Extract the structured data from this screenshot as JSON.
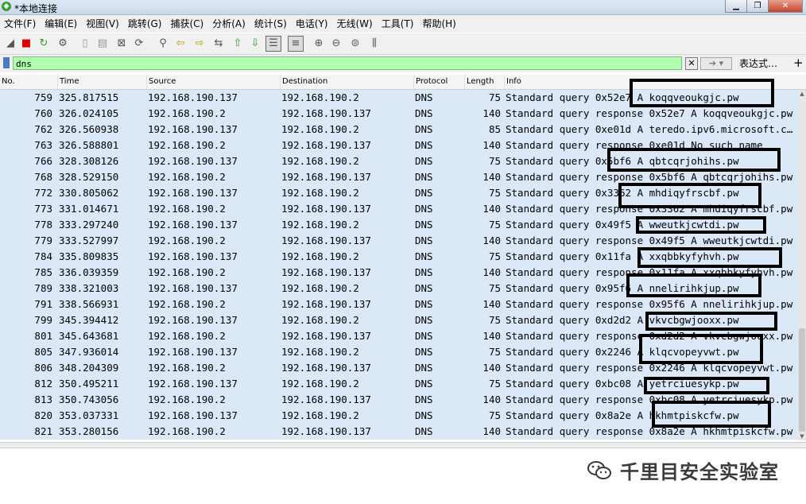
{
  "window": {
    "title": "*本地连接"
  },
  "menu": [
    "文件(F)",
    "编辑(E)",
    "视图(V)",
    "跳转(G)",
    "捕获(C)",
    "分析(A)",
    "统计(S)",
    "电话(Y)",
    "无线(W)",
    "工具(T)",
    "帮助(H)"
  ],
  "filter": {
    "value": "dns",
    "expression_label": "表达式…",
    "add_label": "+"
  },
  "columns": {
    "no": "No.",
    "time": "Time",
    "source": "Source",
    "destination": "Destination",
    "protocol": "Protocol",
    "length": "Length",
    "info": "Info"
  },
  "packets": [
    {
      "no": "759",
      "time": "325.817515",
      "src": "192.168.190.137",
      "dst": "192.168.190.2",
      "proto": "DNS",
      "len": "75",
      "info": "Standard query 0x52e7 A koqqveoukgjc.pw"
    },
    {
      "no": "760",
      "time": "326.024105",
      "src": "192.168.190.2",
      "dst": "192.168.190.137",
      "proto": "DNS",
      "len": "140",
      "info": "Standard query response 0x52e7 A koqqveoukgjc.pw"
    },
    {
      "no": "762",
      "time": "326.560938",
      "src": "192.168.190.137",
      "dst": "192.168.190.2",
      "proto": "DNS",
      "len": "85",
      "info": "Standard query 0xe01d A teredo.ipv6.microsoft.com"
    },
    {
      "no": "763",
      "time": "326.588801",
      "src": "192.168.190.2",
      "dst": "192.168.190.137",
      "proto": "DNS",
      "len": "140",
      "info": "Standard query response 0xe01d No such name"
    },
    {
      "no": "766",
      "time": "328.308126",
      "src": "192.168.190.137",
      "dst": "192.168.190.2",
      "proto": "DNS",
      "len": "75",
      "info": "Standard query 0x5bf6 A qbtcqrjohihs.pw"
    },
    {
      "no": "768",
      "time": "328.529150",
      "src": "192.168.190.2",
      "dst": "192.168.190.137",
      "proto": "DNS",
      "len": "140",
      "info": "Standard query response 0x5bf6 A qbtcqrjohihs.pw"
    },
    {
      "no": "772",
      "time": "330.805062",
      "src": "192.168.190.137",
      "dst": "192.168.190.2",
      "proto": "DNS",
      "len": "75",
      "info": "Standard query 0x3362 A mhdiqyfrscbf.pw"
    },
    {
      "no": "773",
      "time": "331.014671",
      "src": "192.168.190.2",
      "dst": "192.168.190.137",
      "proto": "DNS",
      "len": "140",
      "info": "Standard query response 0x3362 A mhdiqyfrscbf.pw"
    },
    {
      "no": "778",
      "time": "333.297240",
      "src": "192.168.190.137",
      "dst": "192.168.190.2",
      "proto": "DNS",
      "len": "75",
      "info": "Standard query 0x49f5 A wweutkjcwtdi.pw"
    },
    {
      "no": "779",
      "time": "333.527997",
      "src": "192.168.190.2",
      "dst": "192.168.190.137",
      "proto": "DNS",
      "len": "140",
      "info": "Standard query response 0x49f5 A wweutkjcwtdi.pw"
    },
    {
      "no": "784",
      "time": "335.809835",
      "src": "192.168.190.137",
      "dst": "192.168.190.2",
      "proto": "DNS",
      "len": "75",
      "info": "Standard query 0x11fa A xxqbbkyfyhvh.pw"
    },
    {
      "no": "785",
      "time": "336.039359",
      "src": "192.168.190.2",
      "dst": "192.168.190.137",
      "proto": "DNS",
      "len": "140",
      "info": "Standard query response 0x11fa A xxqbbkyfyhvh.pw"
    },
    {
      "no": "789",
      "time": "338.321003",
      "src": "192.168.190.137",
      "dst": "192.168.190.2",
      "proto": "DNS",
      "len": "75",
      "info": "Standard query 0x95f6 A nnelirihkjup.pw"
    },
    {
      "no": "791",
      "time": "338.566931",
      "src": "192.168.190.2",
      "dst": "192.168.190.137",
      "proto": "DNS",
      "len": "140",
      "info": "Standard query response 0x95f6 A nnelirihkjup.pw"
    },
    {
      "no": "799",
      "time": "345.394412",
      "src": "192.168.190.137",
      "dst": "192.168.190.2",
      "proto": "DNS",
      "len": "75",
      "info": "Standard query 0xd2d2 A vkvcbgwjooxx.pw"
    },
    {
      "no": "801",
      "time": "345.643681",
      "src": "192.168.190.2",
      "dst": "192.168.190.137",
      "proto": "DNS",
      "len": "140",
      "info": "Standard query response 0xd2d2 A vkvcbgwjooxx.pw"
    },
    {
      "no": "805",
      "time": "347.936014",
      "src": "192.168.190.137",
      "dst": "192.168.190.2",
      "proto": "DNS",
      "len": "75",
      "info": "Standard query 0x2246 A klqcvopeyvwt.pw"
    },
    {
      "no": "806",
      "time": "348.204309",
      "src": "192.168.190.2",
      "dst": "192.168.190.137",
      "proto": "DNS",
      "len": "140",
      "info": "Standard query response 0x2246 A klqcvopeyvwt.pw"
    },
    {
      "no": "812",
      "time": "350.495211",
      "src": "192.168.190.137",
      "dst": "192.168.190.2",
      "proto": "DNS",
      "len": "75",
      "info": "Standard query 0xbc08 A yetrciuesykp.pw"
    },
    {
      "no": "813",
      "time": "350.743056",
      "src": "192.168.190.2",
      "dst": "192.168.190.137",
      "proto": "DNS",
      "len": "140",
      "info": "Standard query response 0xbc08 A yetrciuesykp.pw"
    },
    {
      "no": "820",
      "time": "353.037331",
      "src": "192.168.190.137",
      "dst": "192.168.190.2",
      "proto": "DNS",
      "len": "75",
      "info": "Standard query 0x8a2e A hkhmtpiskcfw.pw"
    },
    {
      "no": "821",
      "time": "353.280156",
      "src": "192.168.190.2",
      "dst": "192.168.190.137",
      "proto": "DNS",
      "len": "140",
      "info": "Standard query response 0x8a2e A hkhmtpiskcfw.pw"
    }
  ],
  "watermark": "千里目安全实验室",
  "colors": {
    "filter_bg": "#afffaf",
    "row_bg": "#dae8f8",
    "annotation": "#000000"
  }
}
